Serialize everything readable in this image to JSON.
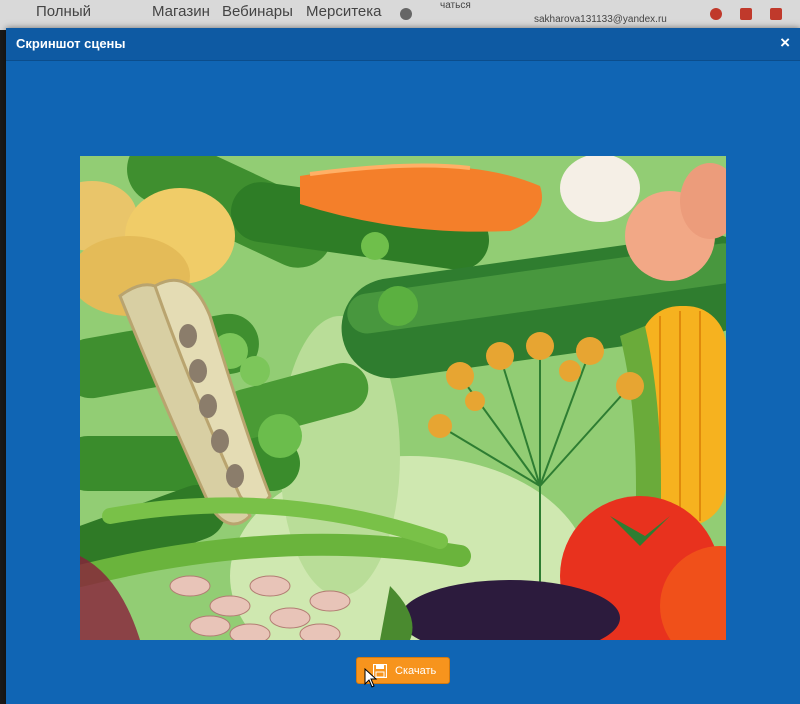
{
  "background_nav": {
    "items": [
      "Полный",
      "Магазин",
      "Вебинары",
      "Мерситека",
      "чаться",
      "sakharova131133@yandex.ru"
    ]
  },
  "modal": {
    "title": "Скриншот сцены",
    "close_symbol": "×",
    "image_alt_icon": "vegetables-illustration",
    "download_label": "Скачать",
    "download_icon": "floppy-disk-icon"
  },
  "colors": {
    "modal_bg": "#1065b4",
    "header_bg": "#0e5aa3",
    "button_bg": "#f7941d"
  }
}
